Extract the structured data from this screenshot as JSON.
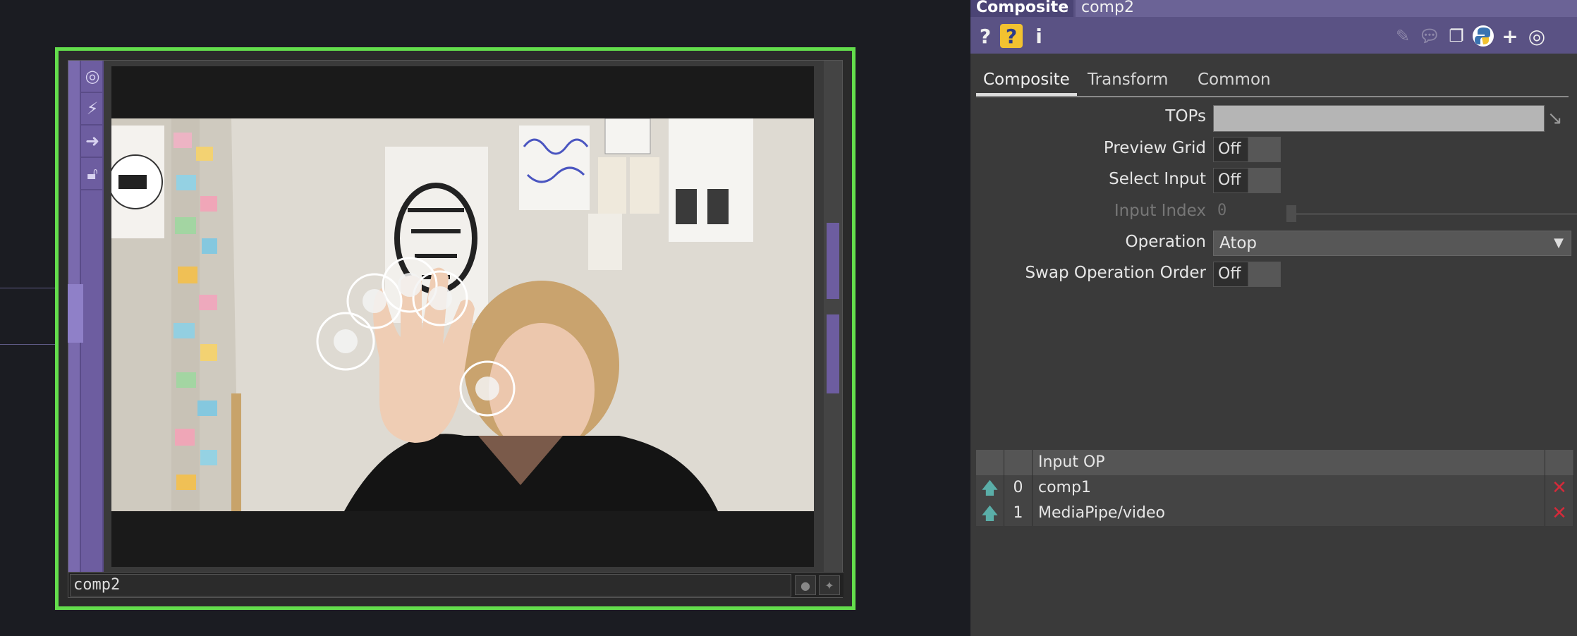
{
  "network": {
    "node_name": "comp2"
  },
  "toolstrip": {
    "icons": [
      "viewer-icon",
      "bypass-icon",
      "export-icon",
      "lock-icon"
    ]
  },
  "panel": {
    "op_type": "Composite",
    "op_name": "comp2",
    "toolbar_icons": [
      "help-icon",
      "python-help-icon",
      "info-icon",
      "edit-icon",
      "comment-icon",
      "clone-icon",
      "python-icon",
      "add-icon",
      "viewer-icon"
    ],
    "tabs": [
      "Composite",
      "Transform",
      "Common"
    ],
    "active_tab": "Composite",
    "params": {
      "tops_label": "TOPs",
      "preview_grid_label": "Preview Grid",
      "preview_grid_value": "Off",
      "select_input_label": "Select Input",
      "select_input_value": "Off",
      "input_index_label": "Input Index",
      "input_index_value": "0",
      "operation_label": "Operation",
      "operation_value": "Atop",
      "swap_label": "Swap Operation Order",
      "swap_value": "Off"
    },
    "sequence": {
      "header": "Input OP",
      "rows": [
        {
          "index": "0",
          "op": "comp1"
        },
        {
          "index": "1",
          "op": "MediaPipe/video"
        }
      ]
    }
  },
  "colors": {
    "node_border": "#63dd4c",
    "panel_header": "#5a5284",
    "delete": "#d42a3a"
  }
}
